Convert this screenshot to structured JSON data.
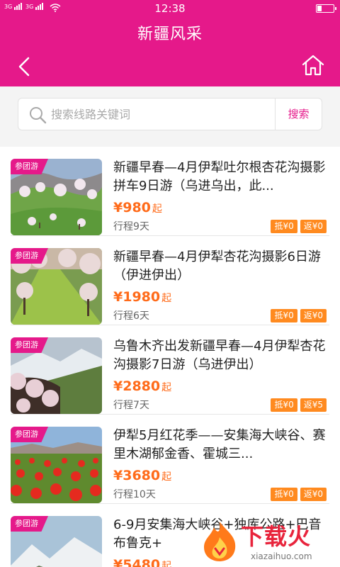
{
  "status": {
    "signal1": "3G",
    "signal2": "3G",
    "time": "12:38"
  },
  "header": {
    "title": "新疆风采"
  },
  "search": {
    "placeholder": "搜索线路关键词",
    "button": "搜索"
  },
  "items": [
    {
      "tag": "参团游",
      "title": "新疆早春—4月伊犁吐尔根杏花沟摄影拼车9日游（乌进乌出，此...",
      "price": "¥980",
      "unit": "起",
      "days": "行程9天",
      "badge1": "抵¥0",
      "badge2": "返¥0"
    },
    {
      "tag": "参团游",
      "title": "新疆早春—4月伊犁杏花沟摄影6日游（伊进伊出）",
      "price": "¥1980",
      "unit": "起",
      "days": "行程6天",
      "badge1": "抵¥0",
      "badge2": "返¥0"
    },
    {
      "tag": "参团游",
      "title": "乌鲁木齐出发新疆早春—4月伊犁杏花沟摄影7日游（乌进伊出）",
      "price": "¥2880",
      "unit": "起",
      "days": "行程7天",
      "badge1": "抵¥0",
      "badge2": "返¥5"
    },
    {
      "tag": "参团游",
      "title": "伊犁5月红花季——安集海大峡谷、赛里木湖郁金香、霍城三...",
      "price": "¥3680",
      "unit": "起",
      "days": "行程10天",
      "badge1": "抵¥0",
      "badge2": "返¥0"
    },
    {
      "tag": "参团游",
      "title": "6-9月安集海大峡谷+独库公路+巴音布鲁克+",
      "price": "¥5480",
      "unit": "起",
      "days": "",
      "badge1": "",
      "badge2": ""
    }
  ],
  "watermark": {
    "text": "下载火",
    "sub": "xiazaihuo.com"
  },
  "colors": {
    "brand": "#e5198a",
    "price": "#ff6b1a",
    "badge": "#ff8a1f"
  }
}
